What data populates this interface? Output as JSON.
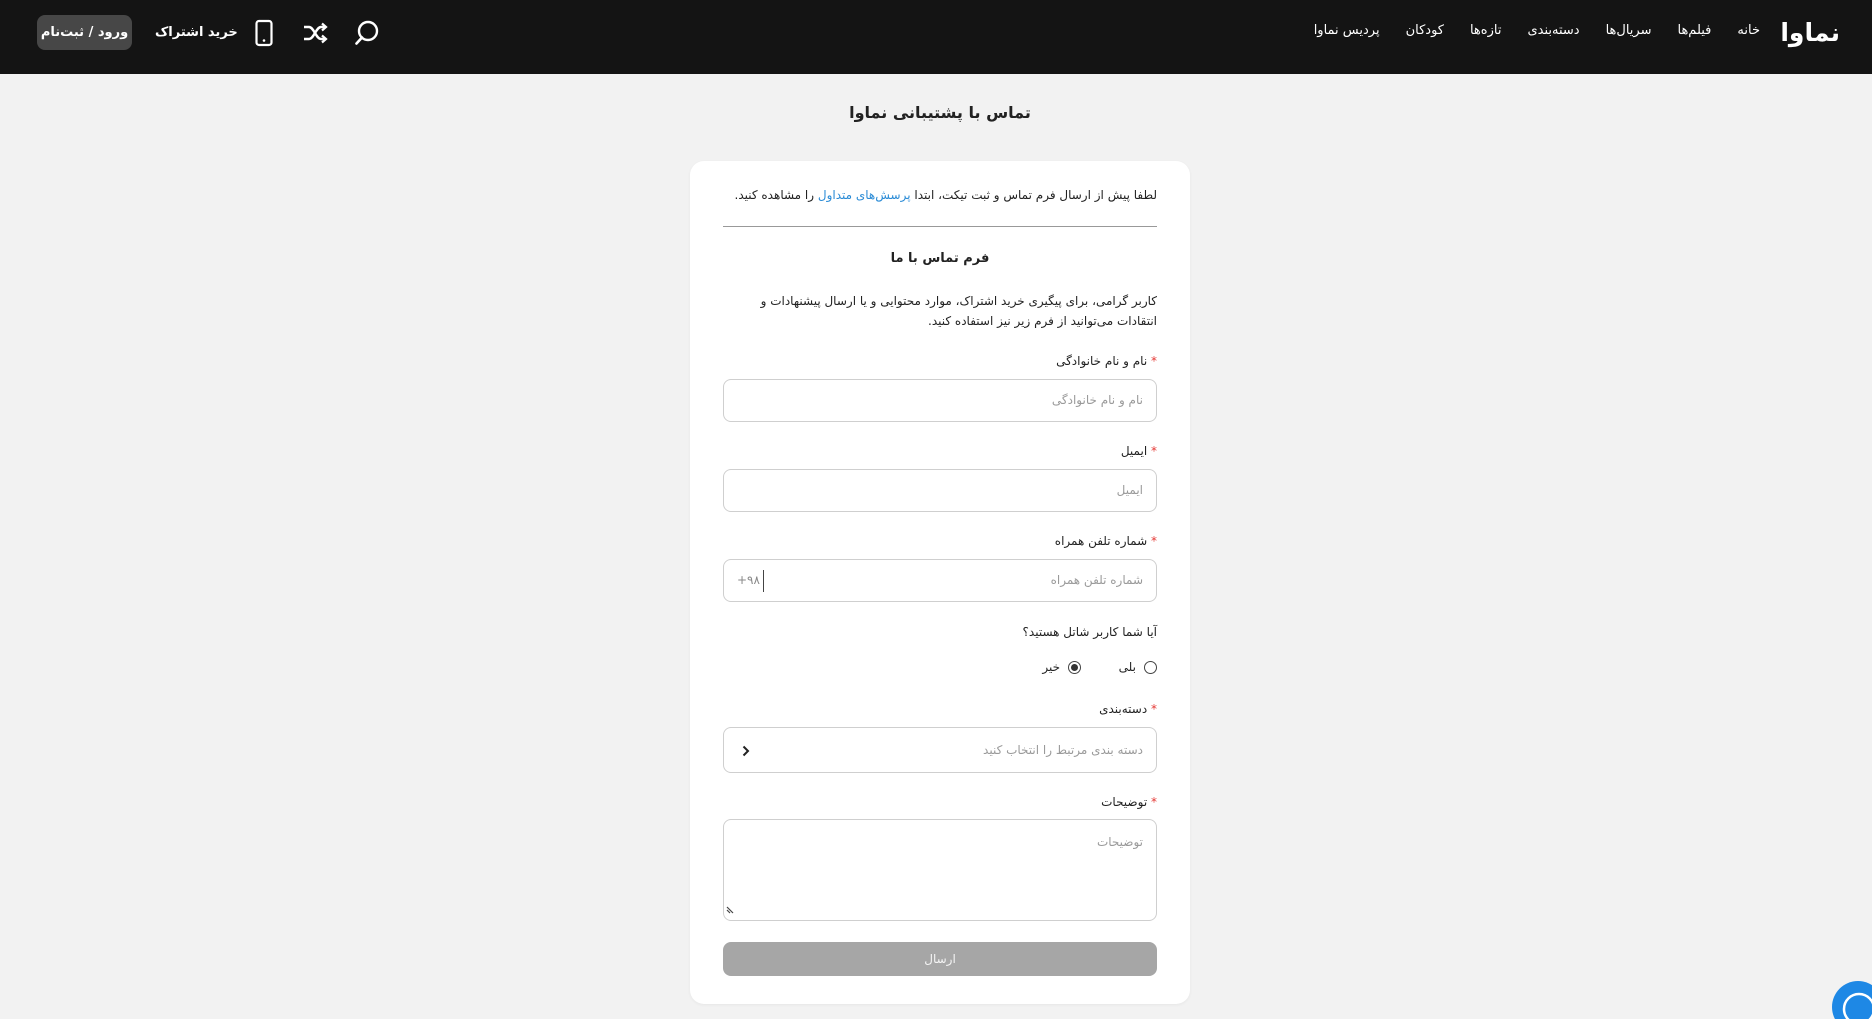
{
  "header": {
    "logo": "نماوا",
    "nav": [
      "خانه",
      "فیلم‌ها",
      "سریال‌ها",
      "دسته‌بندی",
      "تازه‌ها",
      "کودکان",
      "پردیس نماوا"
    ],
    "subscribe_label": "خرید اشتراک",
    "login_label": "ورود / ثبت‌نام",
    "icons": [
      "mobile-icon",
      "shuffle-icon",
      "search-icon"
    ]
  },
  "page": {
    "title": "تماس با پشتیبانی نماوا"
  },
  "form": {
    "notice_before": "لطفا پیش از ارسال فرم تماس و ثبت تیکت، ابتدا",
    "notice_link": "پرسش‌های متداول",
    "notice_after": "را مشاهده کنید.",
    "title": "فرم تماس با ما",
    "intro": "کاربر گرامی، برای پیگیری خرید اشتراک، موارد محتوایی و یا ارسال پیشنهادات و انتقادات می‌توانید از فرم زیر نیز استفاده کنید.",
    "required_mark": "*",
    "name_label": "نام و نام خانوادگی",
    "name_placeholder": "نام و نام خانوادگی",
    "email_label": "ایمیل",
    "email_placeholder": "ایمیل",
    "phone_label": "شماره تلفن همراه",
    "phone_placeholder": "شماره تلفن همراه",
    "phone_prefix": "+۹۸",
    "shatel_question": "آیا شما کاربر شاتل هستید؟",
    "radio_yes": "بلی",
    "radio_no": "خیر",
    "selected_option": "خیر",
    "category_label": "دسته‌بندی",
    "category_placeholder": "دسته بندی مرتبط را انتخاب کنید",
    "description_label": "توضیحات",
    "description_placeholder": "توضیحات",
    "submit_label": "ارسال"
  },
  "colors": {
    "header_bg": "#141414",
    "link": "#2a8bd6",
    "required": "#e53935",
    "submit_disabled": "#a6a6a6",
    "chat": "#1e88e5"
  }
}
